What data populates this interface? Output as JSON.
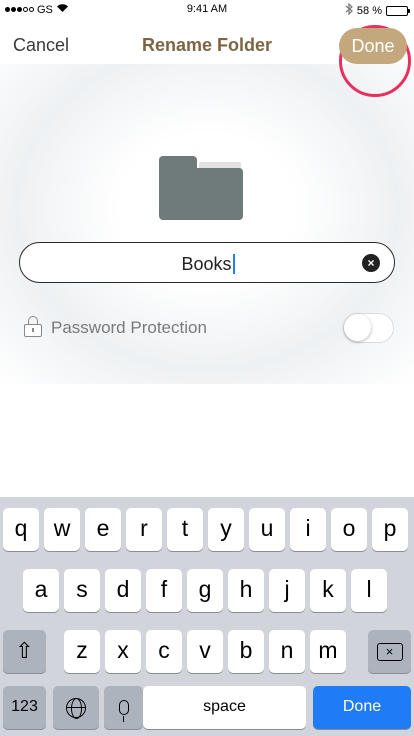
{
  "status_bar": {
    "carrier": "GS",
    "time": "9:41 AM",
    "battery_percent": "58 %",
    "battery_level": 0.58,
    "icons": [
      "signal-icon",
      "wifi-icon",
      "bluetooth-icon",
      "battery-icon"
    ]
  },
  "nav": {
    "cancel_label": "Cancel",
    "title": "Rename Folder",
    "done_label": "Done"
  },
  "folder": {
    "icon": "folder-icon",
    "name_value": "Books"
  },
  "password": {
    "label": "Password Protection",
    "enabled": false,
    "icon": "lock-icon"
  },
  "keyboard": {
    "row1": [
      "q",
      "w",
      "e",
      "r",
      "t",
      "y",
      "u",
      "i",
      "o",
      "p"
    ],
    "row2": [
      "a",
      "s",
      "d",
      "f",
      "g",
      "h",
      "j",
      "k",
      "l"
    ],
    "row3": [
      "z",
      "x",
      "c",
      "v",
      "b",
      "n",
      "m"
    ],
    "numbers_label": "123",
    "space_label": "space",
    "done_label": "Done"
  },
  "colors": {
    "accent": "#c3a77d",
    "title": "#7d6544",
    "highlight_ring": "#e8305f",
    "keyboard_done": "#1f7cf6",
    "folder": "#6f7b7b"
  }
}
